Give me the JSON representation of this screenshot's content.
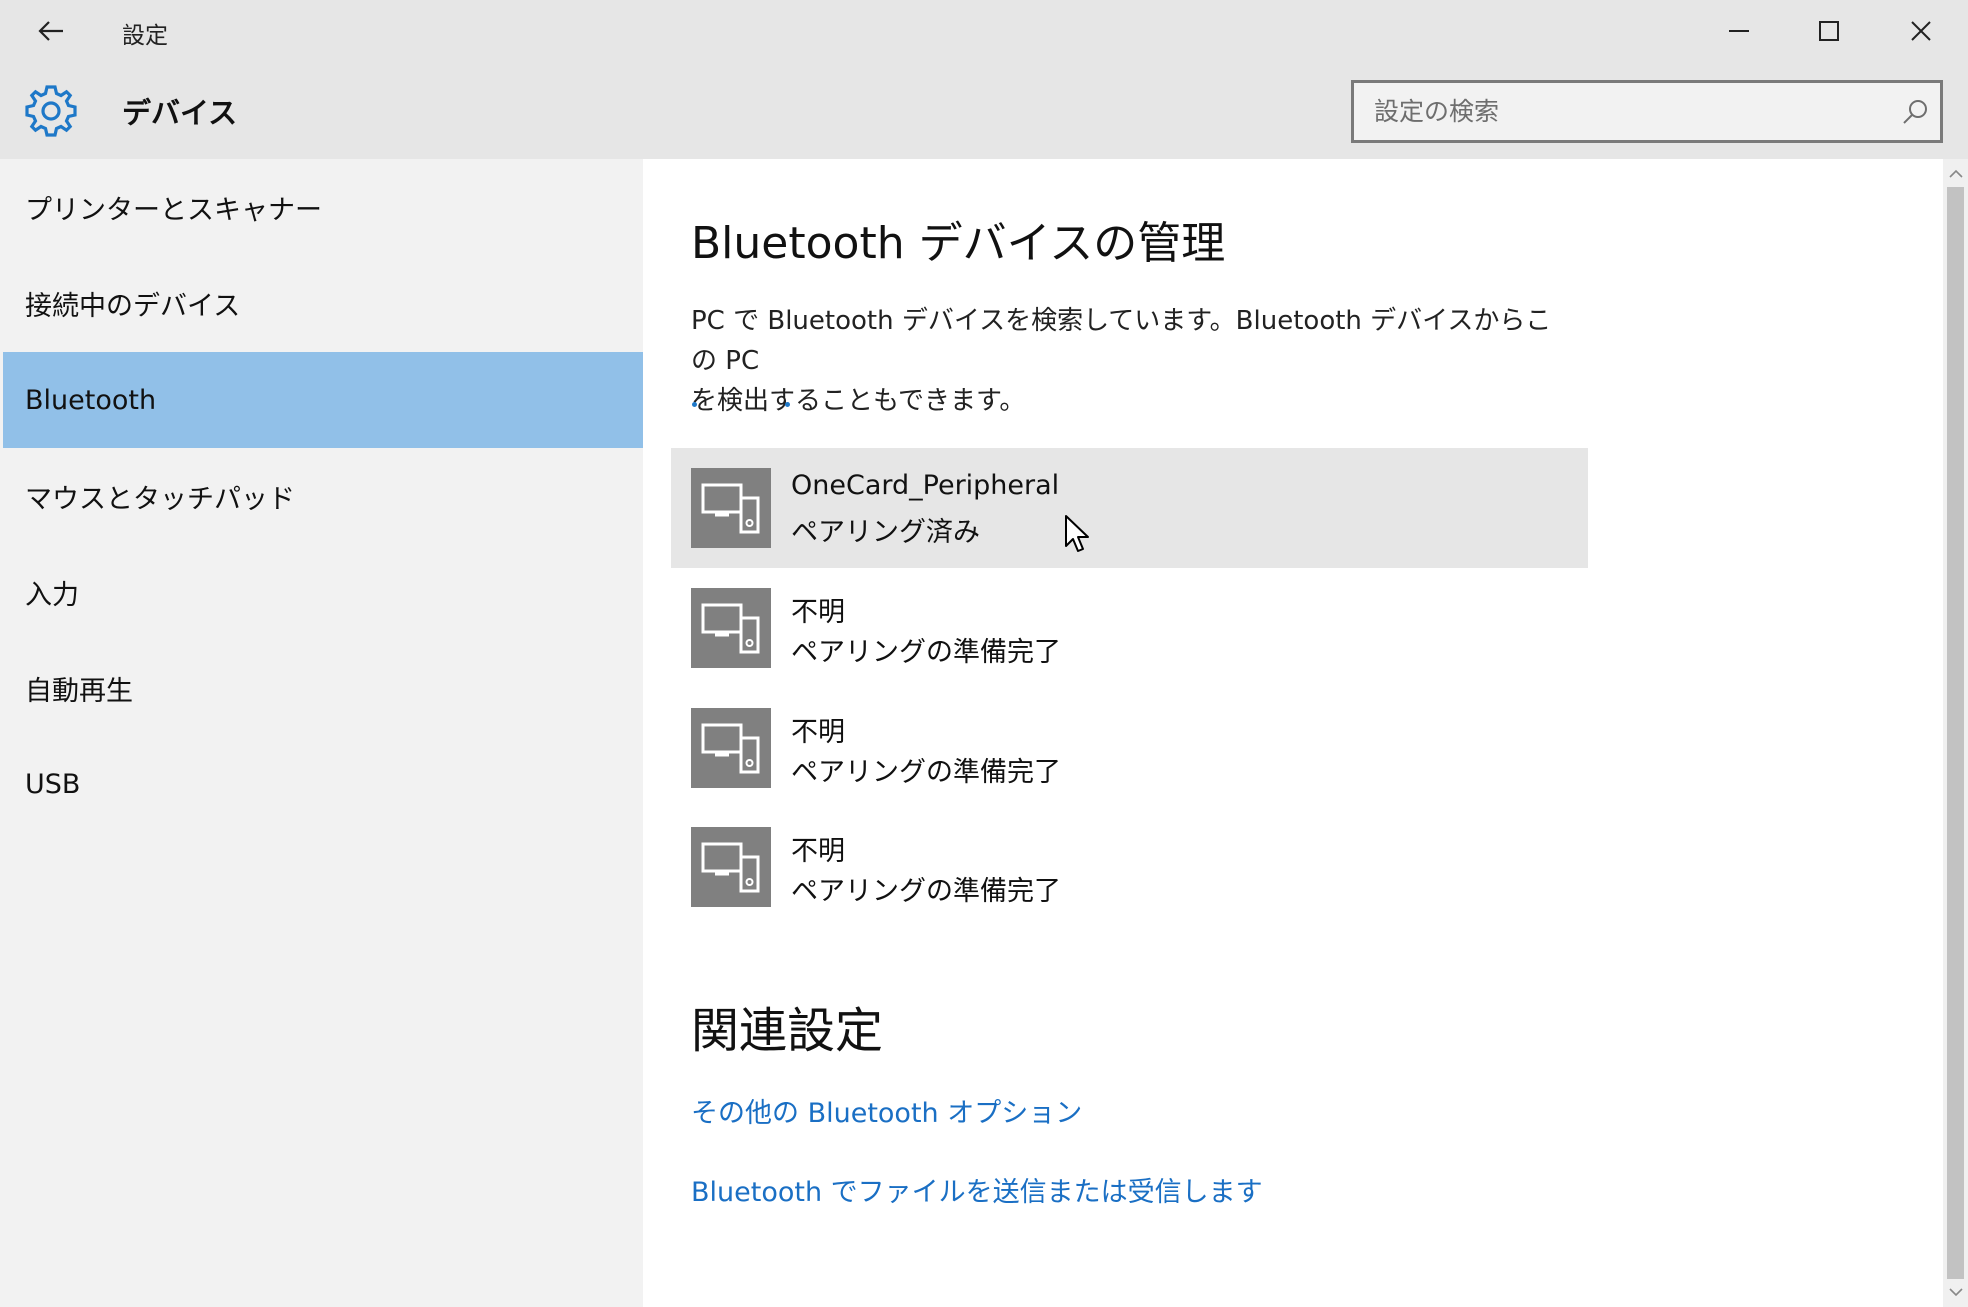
{
  "window": {
    "title": "設定",
    "back_icon": "back-arrow-icon",
    "controls": [
      "minimize-icon",
      "maximize-icon",
      "close-icon"
    ]
  },
  "header": {
    "icon": "gear-icon",
    "section_title": "デバイス",
    "search_placeholder": "設定の検索",
    "accent": "#1e78c8"
  },
  "sidebar": {
    "items": [
      {
        "label": "プリンターとスキャナー",
        "selected": false
      },
      {
        "label": "接続中のデバイス",
        "selected": false
      },
      {
        "label": "Bluetooth",
        "selected": true
      },
      {
        "label": "マウスとタッチパッド",
        "selected": false
      },
      {
        "label": "入力",
        "selected": false
      },
      {
        "label": "自動再生",
        "selected": false
      },
      {
        "label": "USB",
        "selected": false
      }
    ],
    "selected_color": "#91c0e8"
  },
  "main": {
    "title": "Bluetooth デバイスの管理",
    "description_line1": "PC で Bluetooth デバイスを検索しています。Bluetooth デバイスからこの PC",
    "description_line2": "を検出することもできます。",
    "devices": [
      {
        "name": "OneCard_Peripheral",
        "status": "ペアリング済み",
        "icon": "device-icon"
      },
      {
        "name": "不明",
        "status": "ペアリングの準備完了",
        "icon": "device-icon"
      },
      {
        "name": "不明",
        "status": "ペアリングの準備完了",
        "icon": "device-icon"
      },
      {
        "name": "不明",
        "status": "ペアリングの準備完了",
        "icon": "device-icon"
      }
    ],
    "related_title": "関連設定",
    "links": [
      "その他の Bluetooth オプション",
      "Bluetooth でファイルを送信または受信します"
    ],
    "link_color": "#1a6fc4"
  }
}
